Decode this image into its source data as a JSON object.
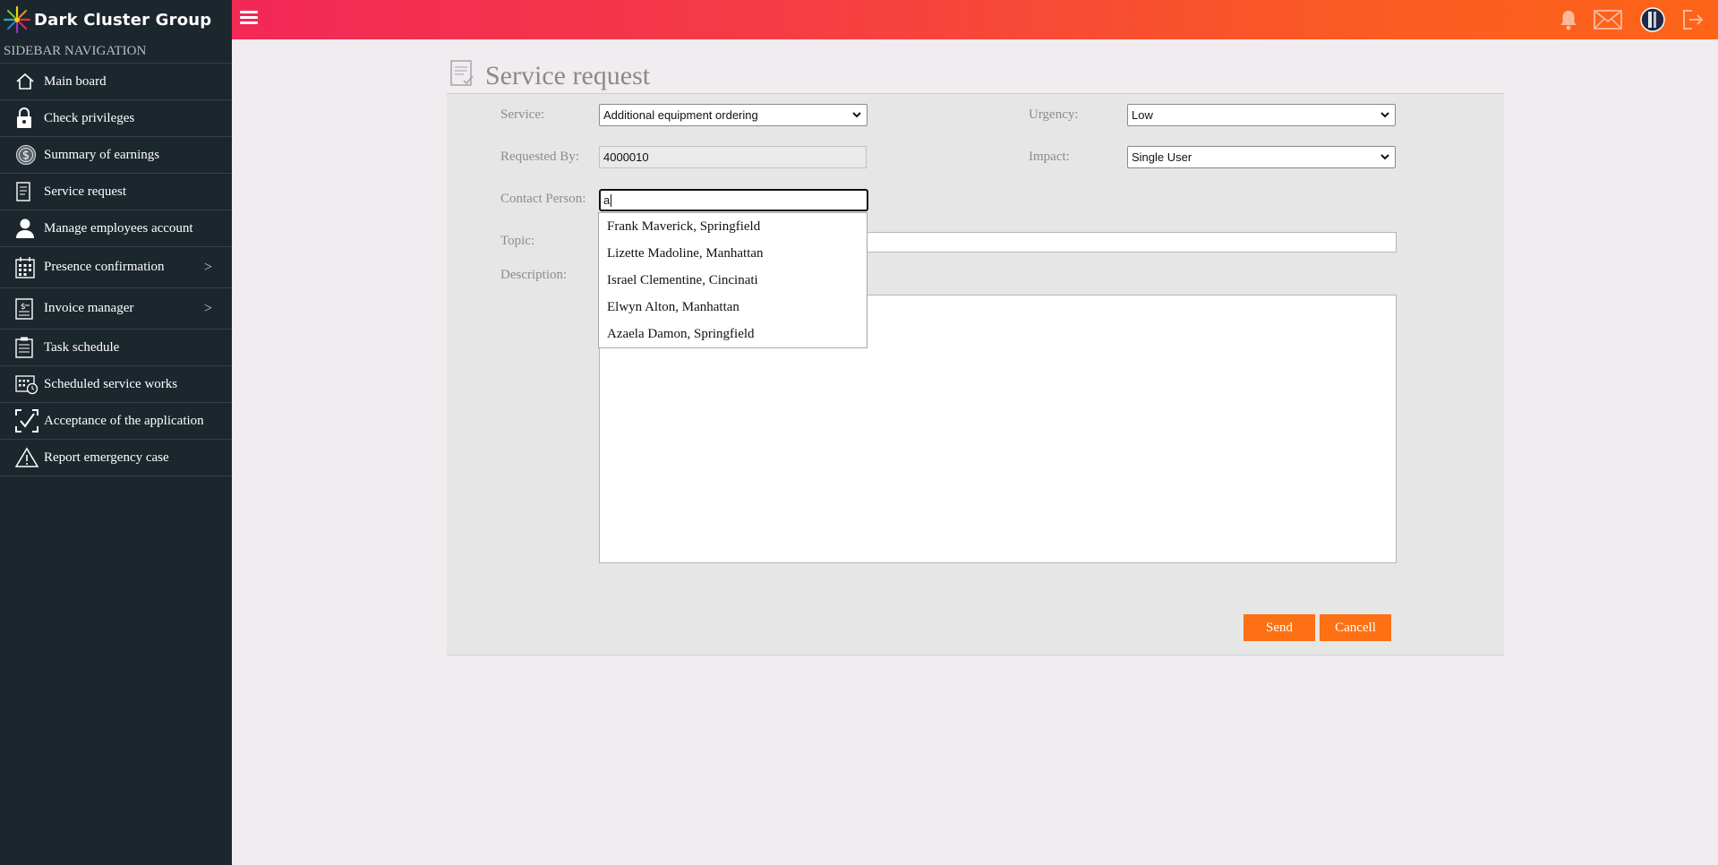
{
  "brand": {
    "name": "Dark Cluster Group",
    "logo_icon": "starburst-logo-icon"
  },
  "header": {
    "menu_icon": "hamburger-icon",
    "icons": [
      "bell-icon",
      "mail-icon",
      "avatar",
      "logout-icon"
    ]
  },
  "sidebar": {
    "title": "SIDEBAR NAVIGATION",
    "items": [
      {
        "label": "Main board",
        "icon": "home-icon"
      },
      {
        "label": "Check privileges",
        "icon": "lock-icon"
      },
      {
        "label": "Summary of earnings",
        "icon": "dollar-icon"
      },
      {
        "label": "Service request",
        "icon": "document-icon"
      },
      {
        "label": "Manage employees account",
        "icon": "user-icon"
      },
      {
        "label": "Presence confirmation",
        "icon": "calendar-icon",
        "chevron": ">"
      },
      {
        "label": "Invoice manager",
        "icon": "invoice-icon",
        "chevron": ">"
      },
      {
        "label": "Task schedule",
        "icon": "clipboard-icon"
      },
      {
        "label": "Scheduled service works",
        "icon": "calendar-clock-icon"
      },
      {
        "label": "Acceptance of the application",
        "icon": "check-frame-icon"
      },
      {
        "label": "Report emergency case",
        "icon": "warning-icon"
      }
    ]
  },
  "page": {
    "title": "Service request",
    "title_icon": "document-check-icon"
  },
  "form": {
    "service_label": "Service:",
    "service_value": "Additional equipment ordering",
    "urgency_label": "Urgency:",
    "urgency_value": "Low",
    "requested_by_label": "Requested By:",
    "requested_by_value": "4000010",
    "impact_label": "Impact:",
    "impact_value": "Single User",
    "contact_label": "Contact Person:",
    "contact_value": "a",
    "topic_label": "Topic:",
    "description_label": "Description:",
    "suggestions": [
      "Frank Maverick, Springfield",
      "Lizette Madoline, Manhattan",
      "Israel Clementine, Cincinati",
      "Elwyn Alton, Manhattan",
      "Azaela Damon, Springfield"
    ],
    "send_label": "Send",
    "cancel_label": "Cancell"
  },
  "colors": {
    "accent": "#fd7014",
    "sidebar": "#1c262d",
    "gradient_start": "#f01f5e",
    "gradient_end": "#fd6418"
  }
}
